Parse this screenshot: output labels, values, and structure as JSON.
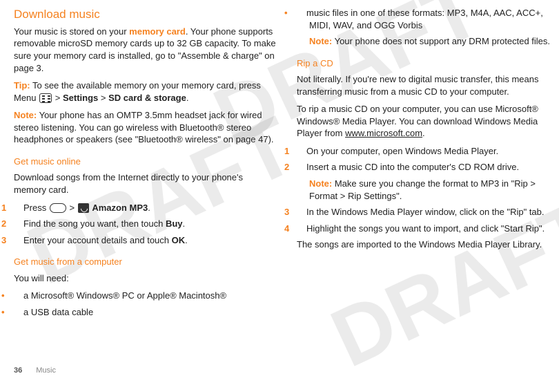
{
  "watermark": "DRAFT",
  "left": {
    "title": "Download music",
    "intro_pre": "Your music is stored on your ",
    "intro_hl": "memory card",
    "intro_post": ". Your phone supports removable microSD memory cards up to 32 GB capacity. To make sure your memory card is installed, go to \"Assemble & charge\" on page 3.",
    "tip_label": "Tip:",
    "tip_text_1": " To see the available memory on your memory card, press Menu ",
    "tip_settings": "Settings",
    "tip_sd": "SD card & storage",
    "note_label": "Note:",
    "note_text": " Your phone has an OMTP 3.5mm headset jack for wired stereo listening. You can go wireless with Bluetooth® stereo headphones or speakers (see \"Bluetooth® wireless\" on page 47).",
    "sub1": "Get music online",
    "sub1_text": "Download songs from the Internet directly to your phone's memory card.",
    "step1_press": "Press ",
    "step1_amazon": "Amazon MP3",
    "step2_pre": "Find the song you want, then touch ",
    "step2_buy": "Buy",
    "step3_pre": "Enter your account details and touch ",
    "step3_ok": "OK",
    "sub2": "Get music from a computer",
    "sub2_text": "You will need:",
    "b1": "a Microsoft® Windows® PC or Apple® Macintosh®",
    "b2": "a USB data cable",
    "gt": ">"
  },
  "right": {
    "bullet_text": "music files in one of these formats: MP3, M4A, AAC, ACC+, MIDI, WAV, and OGG Vorbis",
    "bullet_note_label": "Note:",
    "bullet_note_text": " Your phone does not support any DRM protected files.",
    "sub": "Rip a CD",
    "p1": "Not literally. If you're new to digital music transfer, this means transferring music from a music CD to your computer.",
    "p2_pre": "To rip a music CD on your computer, you can use Microsoft® Windows® Media Player. You can download Windows Media Player from ",
    "p2_link": "www.microsoft.com",
    "s1": "On your computer, open Windows Media Player.",
    "s2": "Insert a music CD into the computer's CD ROM drive.",
    "s2_note_label": "Note:",
    "s2_note_text": " Make sure you change the format to MP3 in \"Rip > Format > Rip Settings\".",
    "s3": "In the Windows Media Player window, click on the \"Rip\" tab.",
    "s4": "Highlight the songs you want to import, and click \"Start Rip\".",
    "outro": "The songs are imported to the Windows Media Player Library."
  },
  "footer": {
    "page": "36",
    "section": "Music"
  }
}
